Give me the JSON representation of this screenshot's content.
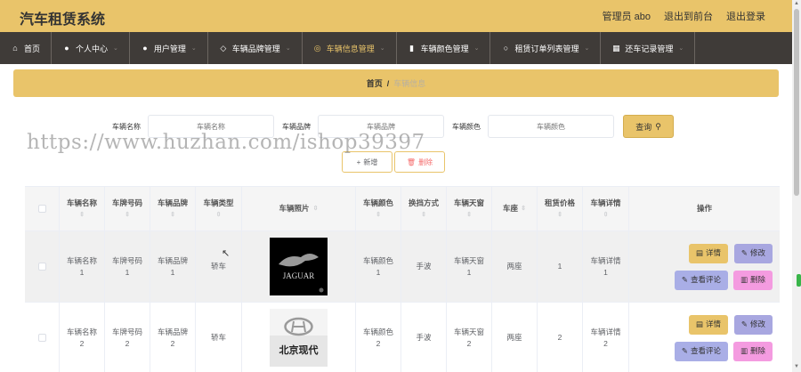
{
  "header": {
    "title": "汽车租赁系统",
    "admin": "管理员 abo",
    "front": "退出到前台",
    "logout": "退出登录"
  },
  "nav": [
    {
      "label": "首页",
      "icon": "home-icon",
      "chevron": false,
      "active": false
    },
    {
      "label": "个人中心",
      "icon": "user-icon",
      "chevron": true,
      "active": false
    },
    {
      "label": "用户管理",
      "icon": "users-icon",
      "chevron": true,
      "active": false
    },
    {
      "label": "车辆品牌管理",
      "icon": "tag-icon",
      "chevron": true,
      "active": false
    },
    {
      "label": "车辆信息管理",
      "icon": "compass-icon",
      "chevron": true,
      "active": true
    },
    {
      "label": "车辆颜色管理",
      "icon": "chart-icon",
      "chevron": true,
      "active": false
    },
    {
      "label": "租赁订单列表管理",
      "icon": "clock-icon",
      "chevron": true,
      "active": false
    },
    {
      "label": "还车记录管理",
      "icon": "grid-icon",
      "chevron": true,
      "active": false
    }
  ],
  "breadcrumb": {
    "home": "首页",
    "sep": "/",
    "current": "车辆信息"
  },
  "search": {
    "name_label": "车辆名称",
    "name_placeholder": "车辆名称",
    "brand_label": "车辆品牌",
    "brand_placeholder": "车辆品牌",
    "color_label": "车辆颜色",
    "color_placeholder": "车辆颜色",
    "query": "查询"
  },
  "actions": {
    "add": "新增",
    "delete": "删除"
  },
  "watermark": "https://www.huzhan.com/ishop39397",
  "table": {
    "columns": [
      "车辆名称",
      "车牌号码",
      "车辆品牌",
      "车辆类型",
      "车辆照片",
      "车辆颜色",
      "换挡方式",
      "车辆天窗",
      "车座",
      "租赁价格",
      "车辆详情",
      "操作"
    ],
    "op_labels": {
      "detail": "详情",
      "edit": "修改",
      "comment": "查看评论",
      "remove": "删除"
    },
    "rows": [
      {
        "name": [
          "车辆名称",
          "1"
        ],
        "plate": [
          "车牌号码",
          "1"
        ],
        "brand": [
          "车辆品牌",
          "1"
        ],
        "type": "轿车",
        "photo_text": "JAGUAR",
        "color": [
          "车辆颜色",
          "1"
        ],
        "gear": "手波",
        "sunroof": [
          "车辆天窗",
          "1"
        ],
        "seat": "两座",
        "price": "1",
        "detail": [
          "车辆详情",
          "1"
        ]
      },
      {
        "name": [
          "车辆名称",
          "2"
        ],
        "plate": [
          "车牌号码",
          "2"
        ],
        "brand": [
          "车辆品牌",
          "2"
        ],
        "type": "轿车",
        "photo_text": "北京现代",
        "color": [
          "车辆颜色",
          "2"
        ],
        "gear": "手波",
        "sunroof": [
          "车辆天窗",
          "2"
        ],
        "seat": "两座",
        "price": "2",
        "detail": [
          "车辆详情",
          "2"
        ]
      }
    ]
  },
  "colors": {
    "accent": "#e9c46a",
    "nav_bg": "#3f3b38",
    "remove": "#f49be0",
    "edit": "#a8a7e0"
  }
}
